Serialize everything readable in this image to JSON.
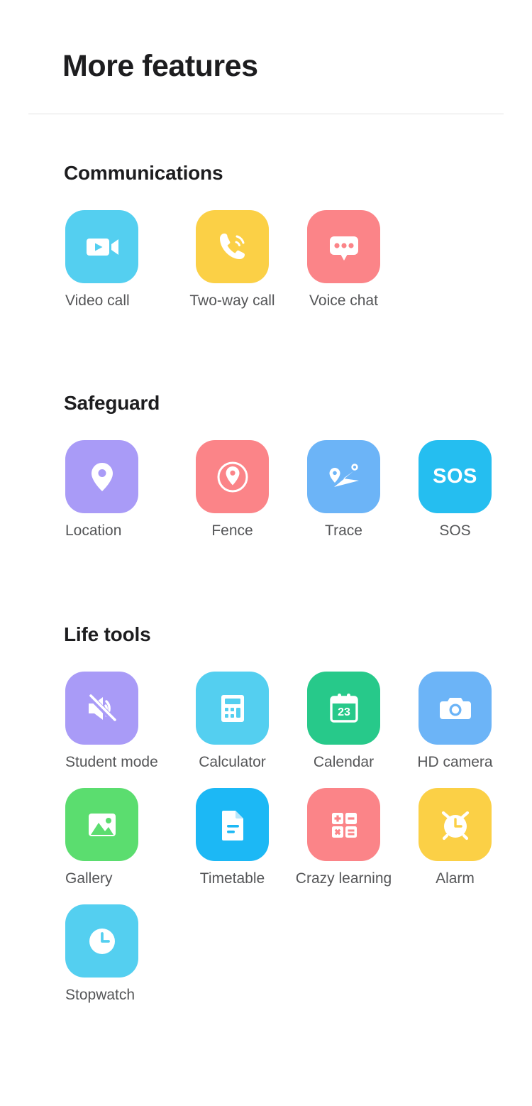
{
  "header": {
    "title": "More features"
  },
  "sections": [
    {
      "id": "communications",
      "title": "Communications",
      "items": [
        {
          "label": "Video call",
          "icon": "video-camera-icon",
          "color": "#54CFF0"
        },
        {
          "label": "Two-way call",
          "icon": "phone-call-icon",
          "color": "#FBD046"
        },
        {
          "label": "Voice chat",
          "icon": "speech-bubble-icon",
          "color": "#FB8488"
        }
      ]
    },
    {
      "id": "safeguard",
      "title": "Safeguard",
      "items": [
        {
          "label": "Location",
          "icon": "map-pin-icon",
          "color": "#A99BF7"
        },
        {
          "label": "Fence",
          "icon": "pin-in-circle-icon",
          "color": "#FB8488"
        },
        {
          "label": "Trace",
          "icon": "route-map-icon",
          "color": "#6CB4F7"
        },
        {
          "label": "SOS",
          "icon": "sos-text-icon",
          "color": "#25BEF0",
          "text": "SOS"
        }
      ]
    },
    {
      "id": "life-tools",
      "title": "Life tools",
      "items": [
        {
          "label": "Student mode",
          "icon": "speaker-mute-icon",
          "color": "#A99BF7"
        },
        {
          "label": "Calculator",
          "icon": "calculator-icon",
          "color": "#54CFF0"
        },
        {
          "label": "Calendar",
          "icon": "calendar-icon",
          "color": "#27C98A",
          "text": "23"
        },
        {
          "label": "HD camera",
          "icon": "camera-icon",
          "color": "#6CB4F7"
        },
        {
          "label": "Gallery",
          "icon": "photo-image-icon",
          "color": "#5BDD6F"
        },
        {
          "label": "Timetable",
          "icon": "document-icon",
          "color": "#1CB8F5"
        },
        {
          "label": "Crazy learning",
          "icon": "math-symbols-icon",
          "color": "#FB8488"
        },
        {
          "label": "Alarm",
          "icon": "alarm-clock-icon",
          "color": "#FBD046"
        },
        {
          "label": "Stopwatch",
          "icon": "clock-icon",
          "color": "#54CFF0"
        }
      ]
    }
  ]
}
